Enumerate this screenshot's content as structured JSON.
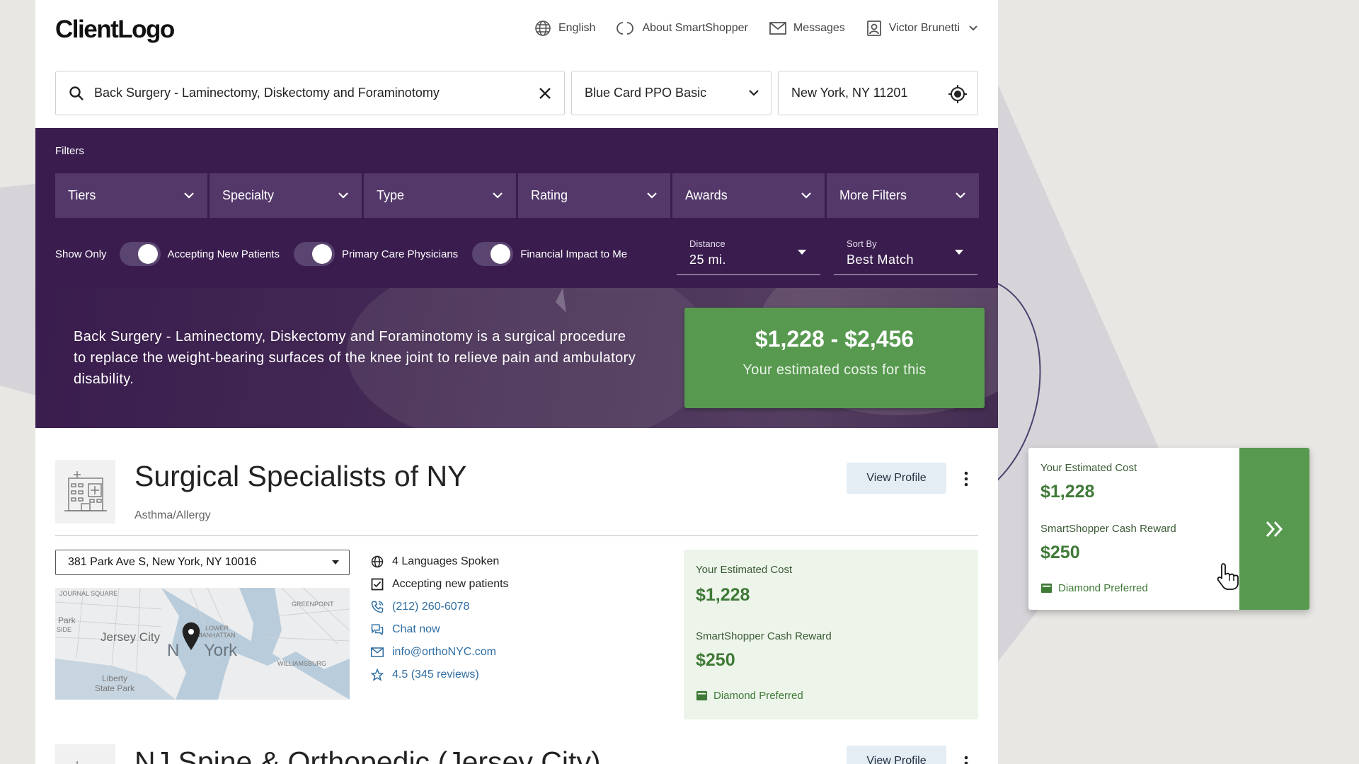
{
  "header": {
    "logo": "ClientLogo",
    "nav": {
      "language": "English",
      "about": "About SmartShopper",
      "messages": "Messages",
      "user": "Victor Brunetti"
    }
  },
  "search": {
    "query": "Back Surgery - Laminectomy, Diskectomy and Foraminotomy",
    "plan": "Blue Card PPO Basic",
    "location": "New York, NY 11201"
  },
  "filters": {
    "label": "Filters",
    "dropdowns": [
      "Tiers",
      "Specialty",
      "Type",
      "Rating",
      "Awards",
      "More Filters"
    ],
    "show_only": "Show Only",
    "toggles": [
      "Accepting New Patients",
      "Primary Care Physicians",
      "Financial Impact to Me"
    ],
    "distance": {
      "label": "Distance",
      "value": "25 mi."
    },
    "sort": {
      "label": "Sort By",
      "value": "Best Match"
    }
  },
  "hero": {
    "description": "Back Surgery - Laminectomy, Diskectomy and Foraminotomy is a surgical procedure to replace the weight-bearing surfaces of the knee joint to relieve pain and ambulatory disability.",
    "cost_range": "$1,228 - $2,456",
    "cost_sub": "Your estimated costs for this"
  },
  "providers": [
    {
      "name": "Surgical Specialists of NY",
      "specialty": "Asthma/Allergy",
      "view_profile": "View Profile",
      "address": "381 Park Ave S, New York, NY 10016",
      "info": {
        "languages": "4 Languages Spoken",
        "accepting": "Accepting new patients",
        "phone": "(212) 260-6078",
        "chat": "Chat now",
        "email": "info@orthoNYC.com",
        "rating": "4.5 (345 reviews)"
      },
      "estimate": {
        "cost_label": "Your Estimated Cost",
        "cost": "$1,228",
        "reward_label": "SmartShopper Cash Reward",
        "reward": "$250",
        "tier": "Diamond Preferred"
      }
    },
    {
      "name": "NJ Spine & Orthopedic (Jersey City)",
      "view_profile": "View Profile"
    }
  ],
  "map": {
    "labels": [
      "JOURNAL SQUARE",
      "Park",
      "SIDE",
      "Jersey City",
      "N",
      "York",
      "GREENPOINT",
      "LOWER",
      "MANHATTAN",
      "WILLIAMSBURG",
      "Liberty",
      "State Park"
    ]
  },
  "float_card": {
    "cost_label": "Your Estimated Cost",
    "cost": "$1,228",
    "reward_label": "SmartShopper Cash Reward",
    "reward": "$250",
    "tier": "Diamond Preferred"
  },
  "colors": {
    "purple_dark": "#3a1d4e",
    "purple_dropdown": "#54386a",
    "green": "#57994f",
    "green_light": "#edf4ea",
    "link": "#2f6ea3"
  }
}
